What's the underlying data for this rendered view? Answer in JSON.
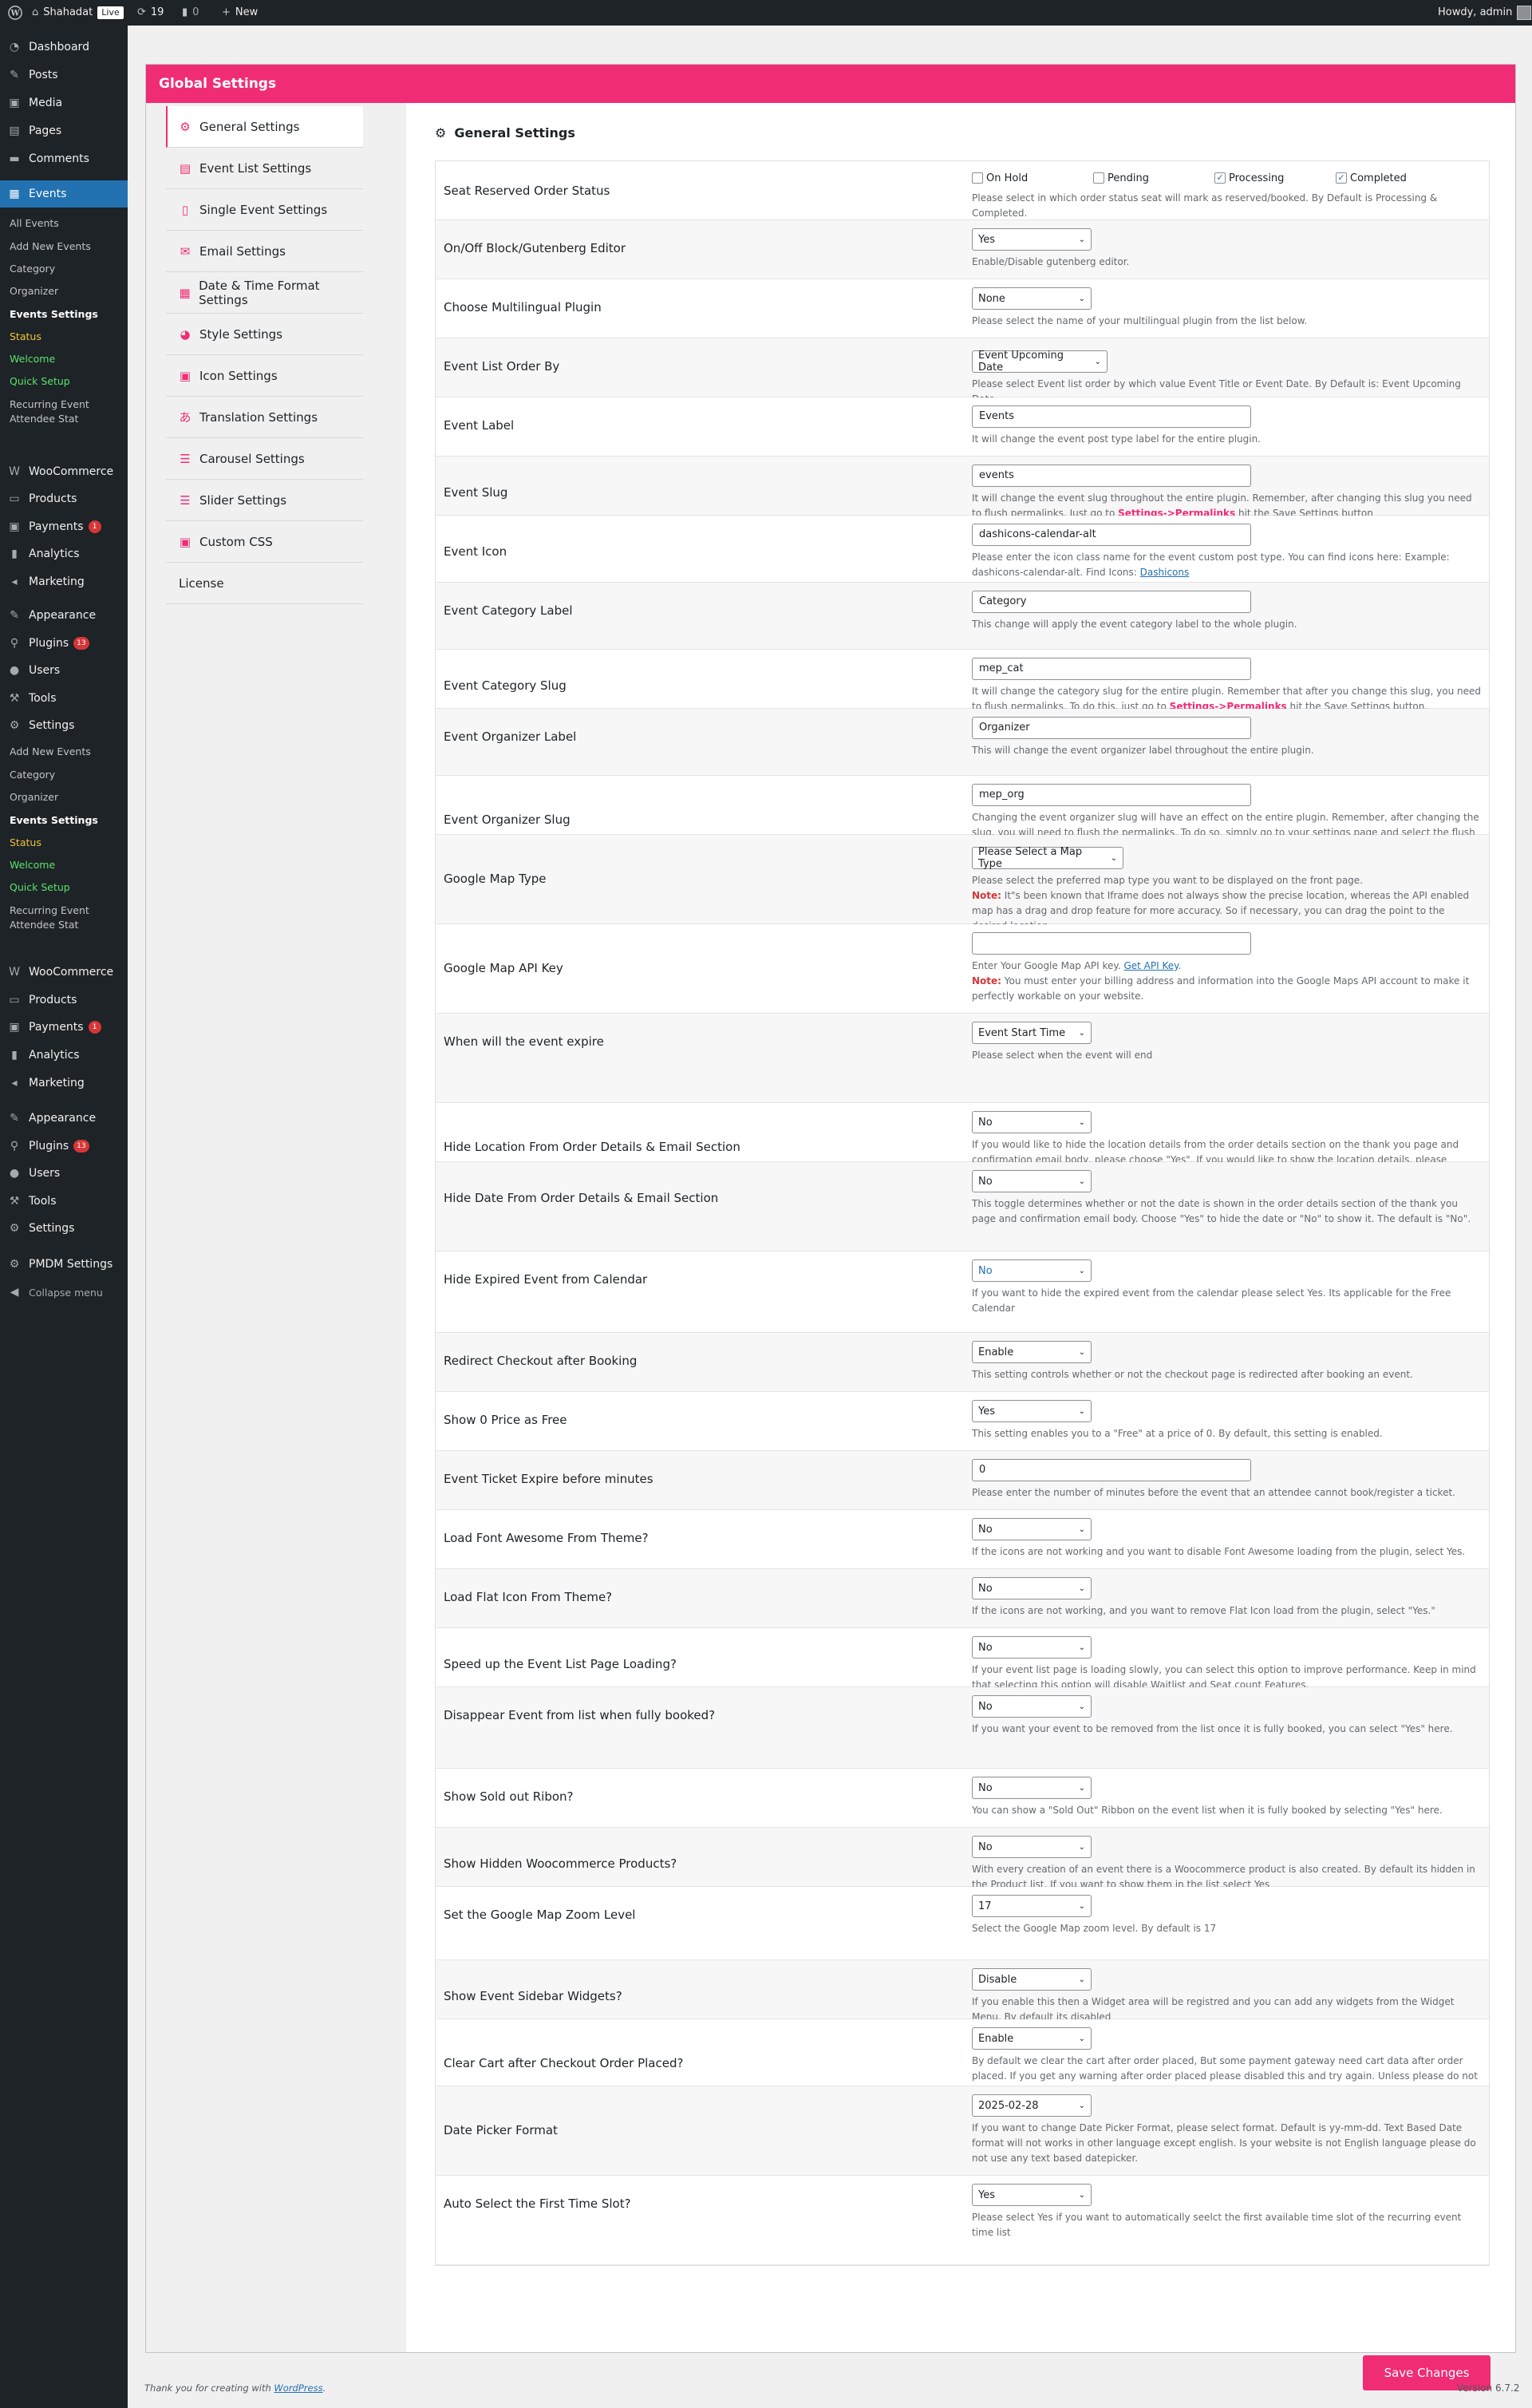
{
  "admin_bar": {
    "site_name": "Shahadat",
    "live_badge": "Live",
    "updates_count": "19",
    "comments_count": "0",
    "new_label": "New",
    "howdy": "Howdy, admin"
  },
  "sidebar": {
    "dashboard": "Dashboard",
    "posts": "Posts",
    "media": "Media",
    "pages": "Pages",
    "comments": "Comments",
    "events": "Events",
    "events_sub": [
      "All Events",
      "Add New Events",
      "Category",
      "Organizer",
      "Events Settings",
      "Status",
      "Welcome",
      "Quick Setup",
      "Recurring Event",
      "Attendee Stat"
    ],
    "woocommerce": "WooCommerce",
    "products": "Products",
    "payments": "Payments",
    "payments_badge": "1",
    "analytics": "Analytics",
    "marketing": "Marketing",
    "appearance": "Appearance",
    "plugins": "Plugins",
    "plugins_badge": "13",
    "users": "Users",
    "tools": "Tools",
    "settings": "Settings",
    "settings_sub": [
      "Add New Events",
      "Category",
      "Organizer",
      "Events Settings",
      "Status",
      "Welcome",
      "Quick Setup",
      "Recurring Event",
      "Attendee Stat"
    ],
    "woocommerce2": "WooCommerce",
    "products2": "Products",
    "payments2": "Payments",
    "payments2_badge": "1",
    "analytics2": "Analytics",
    "marketing2": "Marketing",
    "appearance2": "Appearance",
    "plugins2": "Plugins",
    "plugins2_badge": "13",
    "users2": "Users",
    "tools2": "Tools",
    "settings2": "Settings",
    "pmdm": "PMDM Settings",
    "collapse": "Collapse menu"
  },
  "page": {
    "header": "Global Settings",
    "panel_title": "General Settings",
    "save_button": "Save Changes"
  },
  "tabs": [
    "General Settings",
    "Event List Settings",
    "Single Event Settings",
    "Email Settings",
    "Date & Time Format Settings",
    "Style Settings",
    "Icon Settings",
    "Translation Settings",
    "Carousel Settings",
    "Slider Settings",
    "Custom CSS",
    "License"
  ],
  "seat_status": {
    "label": "Seat Reserved Order Status",
    "options": [
      "On Hold",
      "Pending",
      "Processing",
      "Completed"
    ],
    "checked": [
      false,
      false,
      true,
      true
    ],
    "desc": "Please select in which order status seat will mark as reserved/booked. By Default is Processing & Completed."
  },
  "settings": [
    {
      "label": "On/Off Block/Gutenberg Editor",
      "value": "Yes",
      "desc": "Enable/Disable gutenberg editor."
    },
    {
      "label": "Choose Multilingual Plugin",
      "value": "None",
      "desc": "Please select the name of your multilingual plugin from the list below."
    },
    {
      "label": "Event List Order By",
      "value": "Event Upcoming Date",
      "desc": "Please select Event list order by which value Event Title or Event Date. By Default is: Event Upcoming Date"
    },
    {
      "label": "Event Label",
      "value": "Events",
      "desc": "It will change the event post type label for the entire plugin."
    },
    {
      "label": "Event Slug",
      "value": "events",
      "desc_a": "It will change the event slug throughout the entire plugin. Remember, after changing this slug you need to flush permalinks. Just go to ",
      "desc_mk": "Settings->Permalinks",
      "desc_b": " hit the Save Settings button"
    },
    {
      "label": "Event Icon",
      "value": "dashicons-calendar-alt",
      "desc_a": "Please enter the icon class name for the event custom post type. You can find icons here: Example: dashicons-calendar-alt. Find Icons: ",
      "desc_link": "Dashicons"
    },
    {
      "label": "Event Category Label",
      "value": "Category",
      "desc": "This change will apply the event category label to the whole plugin."
    },
    {
      "label": "Event Category Slug",
      "value": "mep_cat",
      "desc_a": "It will change the category slug for the entire plugin. Remember that after you change this slug, you need to flush permalinks. To do this, just go to ",
      "desc_mk": "Settings->Permalinks",
      "desc_b": " hit the Save Settings button."
    },
    {
      "label": "Event Organizer Label",
      "value": "Organizer",
      "desc": "This will change the event organizer label throughout the entire plugin."
    },
    {
      "label": "Event Organizer Slug",
      "value": "mep_org",
      "desc_a": "Changing the event organizer slug will have an effect on the entire plugin. Remember, after changing the slug, you will need to flush the permalinks. To do so, simply go to your settings page and select the flush permalinks option. ",
      "desc_mk": "Settings->Permalinks",
      "desc_b": " hit the Save Settings button."
    },
    {
      "label": "Google Map Type",
      "value": "Please Select a Map Type",
      "desc": "Please select the preferred map type you want to be displayed on the front page.",
      "note_label": "Note:",
      "note": " It\"s been known that Iframe does not always show the precise location, whereas the API enabled map has a drag and drop feature for more accuracy. So if necessary, you can drag the point to the desired location."
    },
    {
      "label": "Google Map API Key",
      "value": "",
      "desc_a": "Enter Your Google Map API key. ",
      "desc_link": "Get API Key",
      "desc_b": ".",
      "note_label": "Note:",
      "note": " You must enter your billing address and information into the Google Maps API account to make it perfectly workable on your website."
    },
    {
      "label": "When will the event expire",
      "value": "Event Start Time",
      "desc": "Please select when the event will end"
    },
    {
      "label": "Hide Location From Order Details & Email Section",
      "value": "No",
      "desc": "If you would like to hide the location details from the order details section on the thank you page and confirmation email body, please choose \"Yes\". If you would like to show the location details, please choose \"No\". The default setting is \"No\"."
    },
    {
      "label": "Hide Date From Order Details & Email Section",
      "value": "No",
      "desc": "This toggle determines whether or not the date is shown in the order details section of the thank you page and confirmation email body. Choose \"Yes\" to hide the date or \"No\" to show it. The default is \"No\"."
    },
    {
      "label": "Hide Expired Event from Calendar",
      "value": "No",
      "desc": "If you want to hide the expired event from the calendar please select Yes. Its applicable for the Free Calendar"
    },
    {
      "label": "Redirect Checkout after Booking",
      "value": "Enable",
      "desc": "This setting controls whether or not the checkout page is redirected after booking an event."
    },
    {
      "label": "Show 0 Price as Free",
      "value": "Yes",
      "desc": "This setting enables you to a \"Free\" at a price of 0. By default, this setting is enabled."
    },
    {
      "label": "Event Ticket Expire before minutes",
      "value": "0",
      "desc": "Please enter the number of minutes before the event that an attendee cannot book/register a ticket."
    },
    {
      "label": "Load Font Awesome From Theme?",
      "value": "No",
      "desc": "If the icons are not working and you want to disable Font Awesome loading from the plugin, select Yes."
    },
    {
      "label": "Load Flat Icon From Theme?",
      "value": "No",
      "desc": "If the icons are not working, and you want to remove Flat Icon load from the plugin, select \"Yes.\""
    },
    {
      "label": "Speed up the Event List Page Loading?",
      "value": "No",
      "desc": "If your event list page is loading slowly, you can select this option to improve performance. Keep in mind that selecting this option will disable Waitlist and Seat count Features."
    },
    {
      "label": "Disappear Event from list when fully booked?",
      "value": "No",
      "desc": "If you want your event to be removed from the list once it is fully booked, you can select \"Yes\" here."
    },
    {
      "label": "Show Sold out Ribon?",
      "value": "No",
      "desc": "You can show a \"Sold Out\" Ribbon on the event list when it is fully booked by selecting \"Yes\" here."
    },
    {
      "label": "Show Hidden Woocommerce Products?",
      "value": "No",
      "desc": "With every creation of an event there is a Woocommerce product is also created. By default its hidden in the Product list. If you want to show them in the list select Yes"
    },
    {
      "label": "Set the Google Map Zoom Level",
      "value": "17",
      "desc": "Select the Google Map zoom level. By default is 17"
    },
    {
      "label": "Show Event Sidebar Widgets?",
      "value": "Disable",
      "desc": "If you enable this then a Widget area will be registred and you can add any widgets from the Widget Menu. By default its disabled"
    },
    {
      "label": "Clear Cart after Checkout Order Placed?",
      "value": "Enable",
      "desc": "By default we clear the cart after order placed, But some payment gateway need cart data after order placed. If you get any warning after order placed please disabled this and try again. Unless please do not change this settings."
    },
    {
      "label": "Date Picker Format",
      "value": "2025-02-28",
      "desc": "If you want to change Date Picker Format, please select format. Default is yy-mm-dd. Text Based Date format will not works in other language except english. Is your website is not English language please do not use any text based datepicker."
    },
    {
      "label": "Auto Select the First Time Slot?",
      "value": "Yes",
      "desc": "Please select Yes if you want to automatically seelct the first available time slot of the recurring event time list"
    }
  ],
  "footer": {
    "thanks": "Thank you for creating with ",
    "wp_link": "WordPress",
    "version": "Version 6.7.2"
  }
}
